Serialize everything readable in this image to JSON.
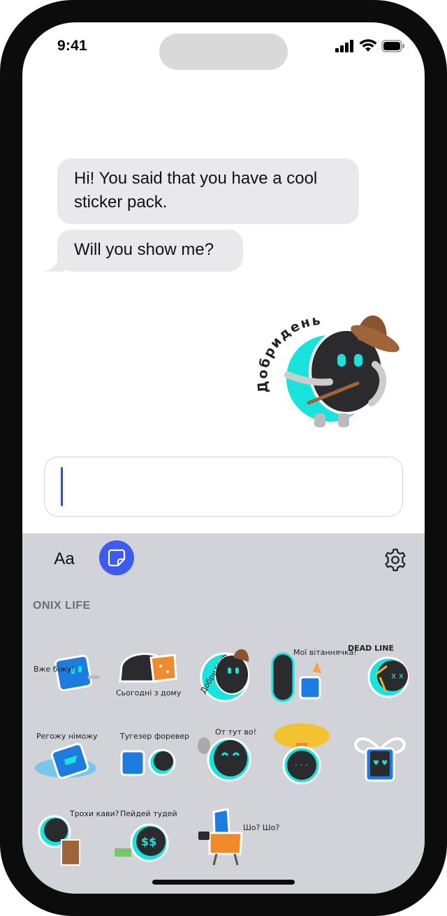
{
  "status_bar": {
    "time": "9:41"
  },
  "chat": {
    "messages": [
      {
        "text": "Hi! You said that you have a cool sticker pack."
      },
      {
        "text": "Will you show me?"
      }
    ],
    "sent_sticker": {
      "caption": "Добридень"
    }
  },
  "composer": {
    "value": ""
  },
  "keyboard": {
    "text_mode_label": "Aa",
    "pack_title": "ONIX LIFE",
    "accent_color": "#3d5af1",
    "stickers": [
      {
        "caption": "Вже біжу!"
      },
      {
        "caption": "Сьогодні з дому"
      },
      {
        "caption": "Добридень"
      },
      {
        "caption": "Мої вітаннячка!"
      },
      {
        "caption": "DEAD LINE"
      },
      {
        "caption": "Регожу німожу"
      },
      {
        "caption": "Тугезер форевер"
      },
      {
        "caption": "От тут во!"
      },
      {
        "caption": ""
      },
      {
        "caption": ""
      },
      {
        "caption": "Трохи кави?"
      },
      {
        "caption": "Пейдей тудей"
      },
      {
        "caption": "Шо? Шо?"
      }
    ]
  },
  "colors": {
    "mascot_cyan": "#19e3dd",
    "mascot_dark": "#2b2b2e",
    "mascot_blue": "#1e7be0"
  }
}
